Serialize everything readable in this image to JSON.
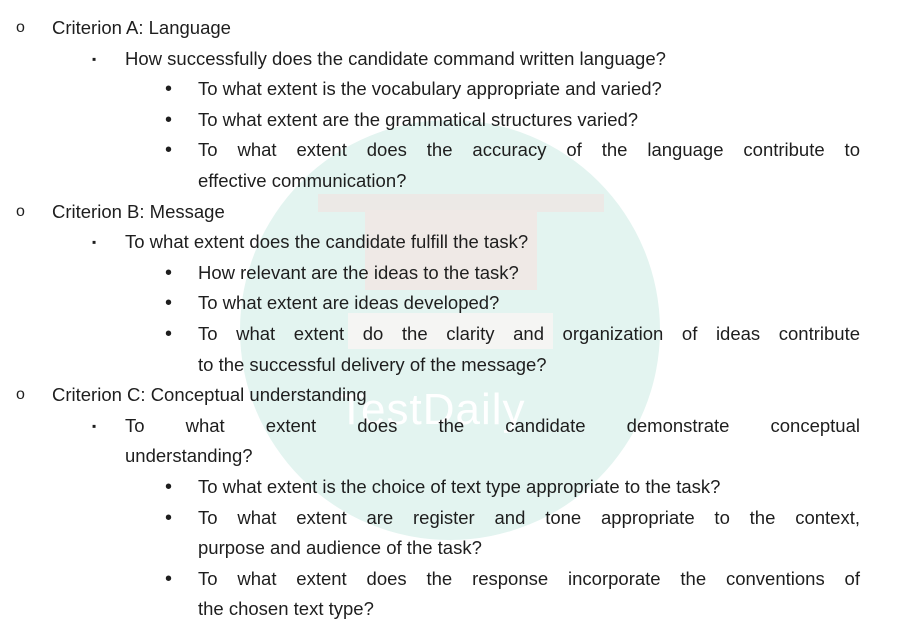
{
  "watermark": "TestDaily",
  "items": [
    {
      "level": 1,
      "marker": "o",
      "lines": [
        "Criterion A: Language"
      ]
    },
    {
      "level": 2,
      "marker": "▪",
      "lines": [
        "How successfully does the candidate command written language?"
      ]
    },
    {
      "level": 3,
      "marker": "•",
      "lines": [
        "To what extent is the vocabulary appropriate and varied?"
      ]
    },
    {
      "level": 3,
      "marker": "•",
      "lines": [
        "To what extent are the grammatical structures varied?"
      ]
    },
    {
      "level": 3,
      "marker": "•",
      "lines": [
        "To what extent does the accuracy of the language contribute to",
        "effective communication?"
      ]
    },
    {
      "level": 1,
      "marker": "o",
      "lines": [
        "Criterion B: Message"
      ]
    },
    {
      "level": 2,
      "marker": "▪",
      "lines": [
        "To what extent does the candidate fulfill the task?"
      ]
    },
    {
      "level": 3,
      "marker": "•",
      "lines": [
        "How relevant are the ideas to the task?"
      ]
    },
    {
      "level": 3,
      "marker": "•",
      "lines": [
        "To what extent are ideas developed?"
      ]
    },
    {
      "level": 3,
      "marker": "•",
      "lines": [
        "To what extent do the clarity and organization of ideas contribute",
        "to the successful delivery of the message?"
      ]
    },
    {
      "level": 1,
      "marker": "o",
      "lines": [
        "Criterion C: Conceptual understanding"
      ]
    },
    {
      "level": 2,
      "marker": "▪",
      "lines": [
        "To what extent does the candidate demonstrate conceptual",
        "understanding?"
      ]
    },
    {
      "level": 3,
      "marker": "•",
      "lines": [
        "To what extent is the choice of text type appropriate to the task?"
      ]
    },
    {
      "level": 3,
      "marker": "•",
      "lines": [
        "To what extent are register and tone appropriate to the context,",
        "purpose and audience of the task?"
      ]
    },
    {
      "level": 3,
      "marker": "•",
      "lines": [
        "To what extent does the response incorporate the conventions of",
        "the chosen text type?"
      ]
    }
  ]
}
